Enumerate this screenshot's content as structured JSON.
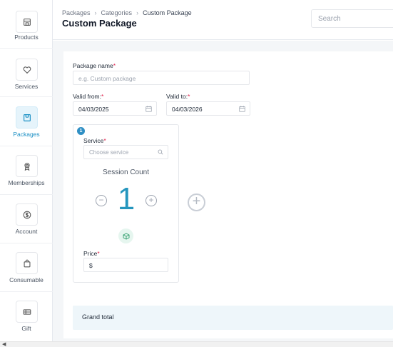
{
  "sidebar": {
    "items": [
      {
        "label": "Products",
        "icon": "storefront-icon"
      },
      {
        "label": "Services",
        "icon": "heart-hand-icon"
      },
      {
        "label": "Packages",
        "icon": "package-icon",
        "active": true
      },
      {
        "label": "Memberships",
        "icon": "badge-icon"
      },
      {
        "label": "Account",
        "icon": "dollar-coin-icon"
      },
      {
        "label": "Consumable",
        "icon": "shopping-bag-icon"
      },
      {
        "label": "Gift",
        "icon": "gift-card-icon"
      }
    ]
  },
  "header": {
    "breadcrumb": [
      "Packages",
      "Categories",
      "Custom Package"
    ],
    "title": "Custom Package",
    "search_placeholder": "Search"
  },
  "form": {
    "package_name_label": "Package name",
    "package_name_placeholder": "e.g. Custom package",
    "valid_from_label": "Valid from:",
    "valid_from_value": "04/03/2025",
    "valid_to_label": "Valid to:",
    "valid_to_value": "04/03/2026",
    "required_mark": "*"
  },
  "service_card": {
    "step": "1",
    "service_label": "Service",
    "service_placeholder": "Choose service",
    "session_count_label": "Session Count",
    "session_count": "1",
    "price_label": "Price",
    "price_value": "$"
  },
  "total": {
    "label": "Grand total"
  },
  "colors": {
    "accent": "#2596be",
    "active_nav": "#1a8fc4",
    "required": "#e11d48",
    "total_bg": "#eef6fa"
  }
}
